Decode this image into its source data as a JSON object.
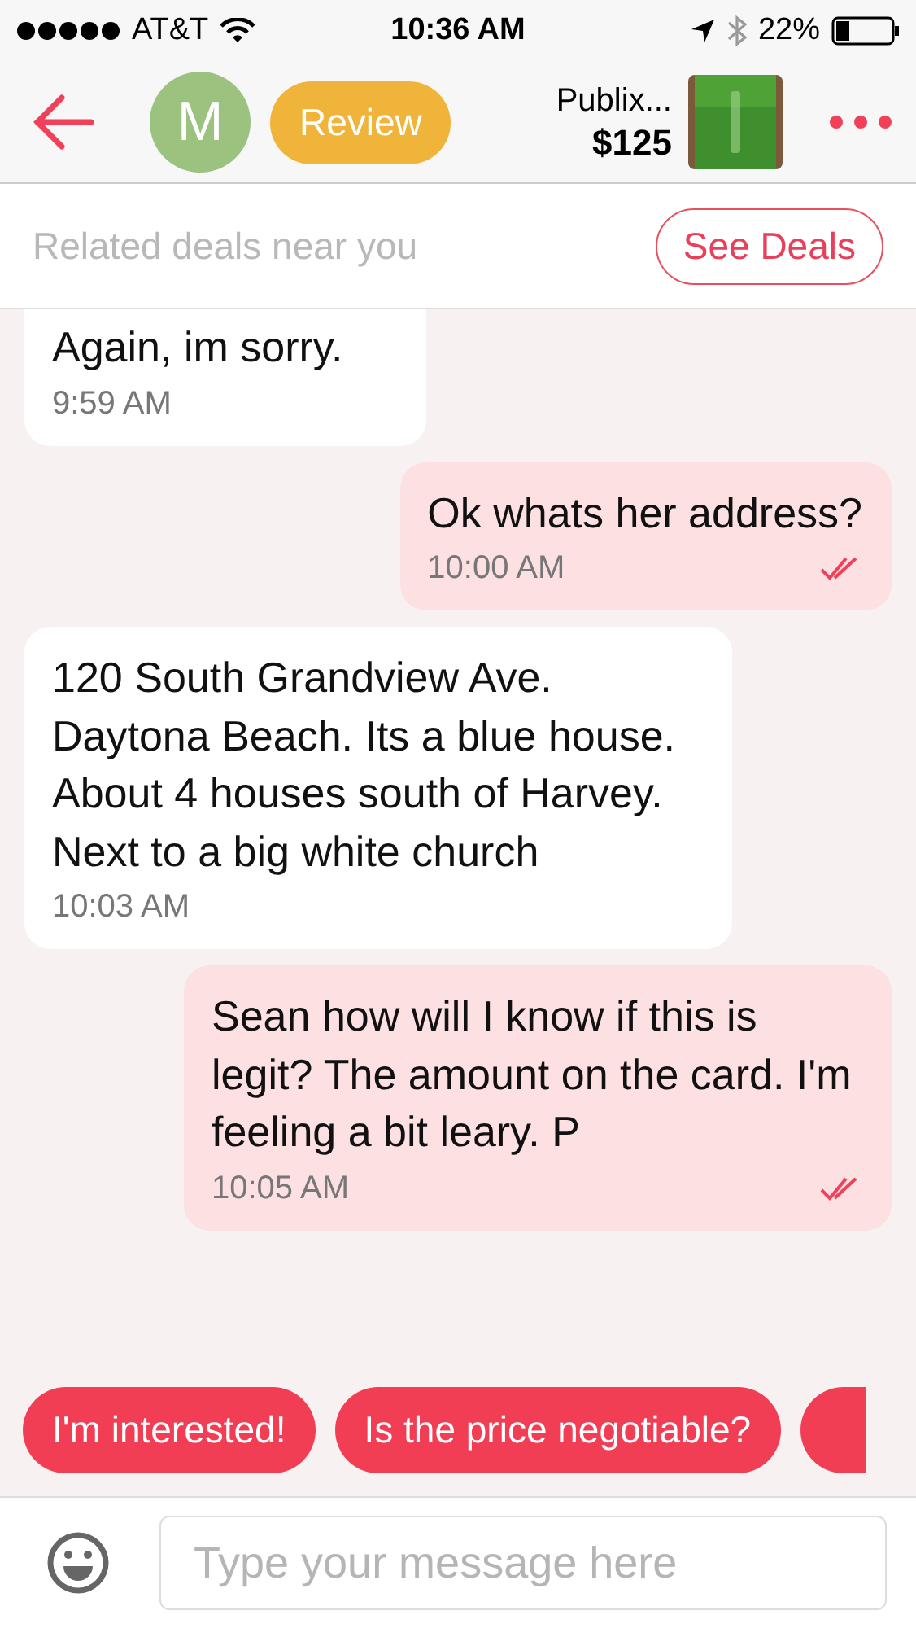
{
  "status_bar": {
    "carrier": "AT&T",
    "time": "10:36 AM",
    "battery": "22%"
  },
  "header": {
    "avatar_letter": "M",
    "review_label": "Review",
    "item_title": "Publix...",
    "item_price": "$125"
  },
  "deals_bar": {
    "text": "Related deals near you",
    "button": "See Deals"
  },
  "messages": [
    {
      "kind": "incoming",
      "text": "Again, im sorry.",
      "time": "9:59 AM"
    },
    {
      "kind": "outgoing",
      "text": "Ok whats her address?",
      "time": "10:00 AM",
      "read": true
    },
    {
      "kind": "incoming",
      "text": "120 South Grandview Ave. Daytona Beach. Its a blue house. About 4 houses south of Harvey. Next to a big white church",
      "time": "10:03 AM"
    },
    {
      "kind": "outgoing",
      "text": "Sean how will I know if this is legit? The amount on the card. I'm feeling a bit leary. P",
      "time": "10:05 AM",
      "read": true
    }
  ],
  "quick_replies": [
    "I'm interested!",
    "Is the price negotiable?"
  ],
  "composer": {
    "placeholder": "Type your message here"
  }
}
